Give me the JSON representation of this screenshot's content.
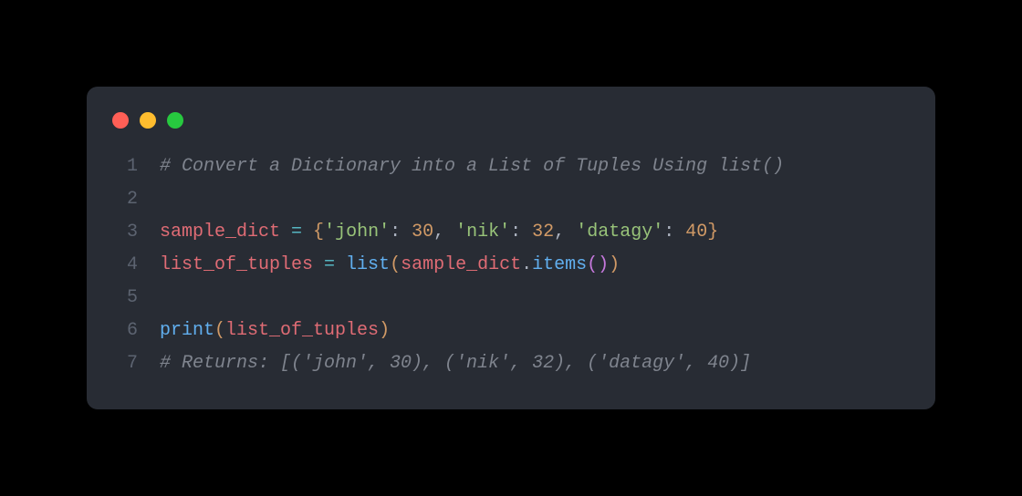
{
  "colors": {
    "background": "#000000",
    "windowBg": "#282c34",
    "dotRed": "#ff5f56",
    "dotYellow": "#ffbd2e",
    "dotGreen": "#27c93f",
    "lineNumber": "#5c6370",
    "comment": "#7f848e",
    "identifier": "#e06c75",
    "operator": "#56b6c2",
    "punctuation": "#abb2bf",
    "brace": "#d19a66",
    "string": "#98c379",
    "number": "#d19a66",
    "builtin": "#61afef",
    "plain": "#abb2bf"
  },
  "lines": {
    "num1": "1",
    "num2": "2",
    "num3": "3",
    "num4": "4",
    "num5": "5",
    "num6": "6",
    "num7": "7"
  },
  "code": {
    "line1_comment": "# Convert a Dictionary into a List of Tuples Using list()",
    "line3": {
      "var": "sample_dict",
      "eq": " = ",
      "lbrace": "{",
      "k1": "'john'",
      "colon1": ": ",
      "v1": "30",
      "comma1": ", ",
      "k2": "'nik'",
      "colon2": ": ",
      "v2": "32",
      "comma2": ", ",
      "k3": "'datagy'",
      "colon3": ": ",
      "v3": "40",
      "rbrace": "}"
    },
    "line4": {
      "var": "list_of_tuples",
      "eq": " = ",
      "fn": "list",
      "lparen": "(",
      "arg": "sample_dict",
      "dot": ".",
      "method": "items",
      "lparen2": "(",
      "rparen2": ")",
      "rparen": ")"
    },
    "line6": {
      "fn": "print",
      "lparen": "(",
      "arg": "list_of_tuples",
      "rparen": ")"
    },
    "line7_comment": "# Returns: [('john', 30), ('nik', 32), ('datagy', 40)]"
  }
}
